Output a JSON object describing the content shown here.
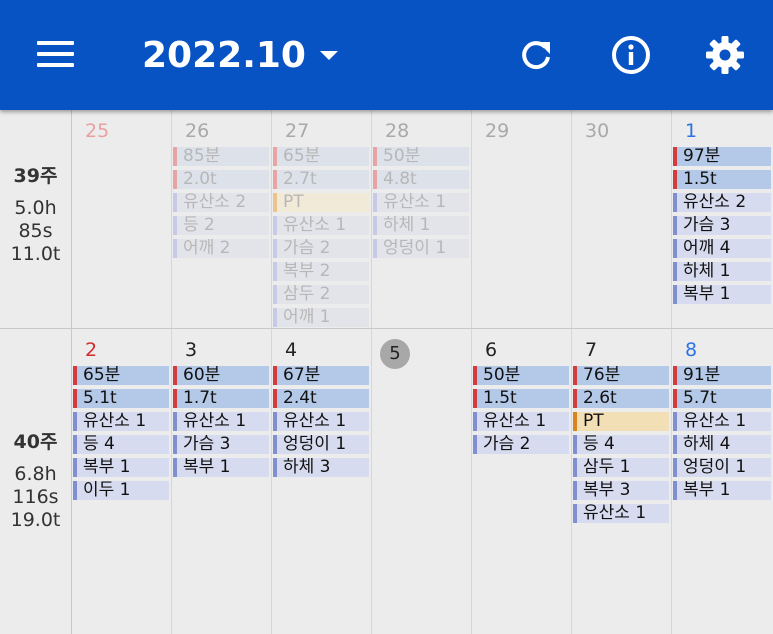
{
  "header": {
    "month": "2022.10",
    "icons": [
      "menu-icon",
      "refresh-icon",
      "info-icon",
      "settings-icon"
    ],
    "color": "#0853c3"
  },
  "weeks": [
    {
      "title": "39주",
      "stats": [
        "5.0h",
        "85s",
        "11.0t"
      ],
      "days": [
        {
          "num": "25",
          "kind": "sun",
          "past": true,
          "items": []
        },
        {
          "num": "26",
          "kind": "",
          "past": true,
          "items": [
            {
              "text": "85분",
              "type": "time"
            },
            {
              "text": "2.0t",
              "type": "ton"
            },
            {
              "text": "유산소 2",
              "type": "ex"
            },
            {
              "text": "등 2",
              "type": "ex"
            },
            {
              "text": "어깨 2",
              "type": "ex"
            }
          ]
        },
        {
          "num": "27",
          "kind": "",
          "past": true,
          "items": [
            {
              "text": "65분",
              "type": "time"
            },
            {
              "text": "2.7t",
              "type": "ton"
            },
            {
              "text": "PT",
              "type": "pt"
            },
            {
              "text": "유산소 1",
              "type": "ex"
            },
            {
              "text": "가슴 2",
              "type": "ex"
            },
            {
              "text": "복부 2",
              "type": "ex"
            },
            {
              "text": "삼두 2",
              "type": "ex"
            },
            {
              "text": "어깨 1",
              "type": "ex"
            }
          ]
        },
        {
          "num": "28",
          "kind": "",
          "past": true,
          "items": [
            {
              "text": "50분",
              "type": "time"
            },
            {
              "text": "4.8t",
              "type": "ton"
            },
            {
              "text": "유산소 1",
              "type": "ex"
            },
            {
              "text": "하체 1",
              "type": "ex"
            },
            {
              "text": "엉덩이 1",
              "type": "ex"
            }
          ]
        },
        {
          "num": "29",
          "kind": "",
          "past": true,
          "items": []
        },
        {
          "num": "30",
          "kind": "",
          "past": true,
          "items": []
        },
        {
          "num": "1",
          "kind": "sat",
          "past": false,
          "items": [
            {
              "text": "97분",
              "type": "time"
            },
            {
              "text": "1.5t",
              "type": "ton"
            },
            {
              "text": "유산소 2",
              "type": "ex"
            },
            {
              "text": "가슴 3",
              "type": "ex"
            },
            {
              "text": "어깨 4",
              "type": "ex"
            },
            {
              "text": "하체 1",
              "type": "ex"
            },
            {
              "text": "복부 1",
              "type": "ex"
            }
          ]
        }
      ]
    },
    {
      "title": "40주",
      "stats": [
        "6.8h",
        "116s",
        "19.0t"
      ],
      "days": [
        {
          "num": "2",
          "kind": "sun",
          "past": false,
          "items": [
            {
              "text": "65분",
              "type": "time"
            },
            {
              "text": "5.1t",
              "type": "ton"
            },
            {
              "text": "유산소 1",
              "type": "ex"
            },
            {
              "text": "등 4",
              "type": "ex"
            },
            {
              "text": "복부 1",
              "type": "ex"
            },
            {
              "text": "이두 1",
              "type": "ex"
            }
          ]
        },
        {
          "num": "3",
          "kind": "",
          "past": false,
          "items": [
            {
              "text": "60분",
              "type": "time"
            },
            {
              "text": "1.7t",
              "type": "ton"
            },
            {
              "text": "유산소 1",
              "type": "ex"
            },
            {
              "text": "가슴 3",
              "type": "ex"
            },
            {
              "text": "복부 1",
              "type": "ex"
            }
          ]
        },
        {
          "num": "4",
          "kind": "",
          "past": false,
          "items": [
            {
              "text": "67분",
              "type": "time"
            },
            {
              "text": "2.4t",
              "type": "ton"
            },
            {
              "text": "유산소 1",
              "type": "ex"
            },
            {
              "text": "엉덩이 1",
              "type": "ex"
            },
            {
              "text": "하체 3",
              "type": "ex"
            }
          ]
        },
        {
          "num": "5",
          "kind": "today",
          "past": false,
          "items": []
        },
        {
          "num": "6",
          "kind": "",
          "past": false,
          "items": [
            {
              "text": "50분",
              "type": "time"
            },
            {
              "text": "1.5t",
              "type": "ton"
            },
            {
              "text": "유산소 1",
              "type": "ex"
            },
            {
              "text": "가슴 2",
              "type": "ex"
            }
          ]
        },
        {
          "num": "7",
          "kind": "",
          "past": false,
          "items": [
            {
              "text": "76분",
              "type": "time"
            },
            {
              "text": "2.6t",
              "type": "ton"
            },
            {
              "text": "PT",
              "type": "pt"
            },
            {
              "text": "등 4",
              "type": "ex"
            },
            {
              "text": "삼두 1",
              "type": "ex"
            },
            {
              "text": "복부 3",
              "type": "ex"
            },
            {
              "text": "유산소 1",
              "type": "ex"
            }
          ]
        },
        {
          "num": "8",
          "kind": "sat",
          "past": false,
          "items": [
            {
              "text": "91분",
              "type": "time"
            },
            {
              "text": "5.7t",
              "type": "ton"
            },
            {
              "text": "유산소 1",
              "type": "ex"
            },
            {
              "text": "하체 4",
              "type": "ex"
            },
            {
              "text": "엉덩이 1",
              "type": "ex"
            },
            {
              "text": "복부 1",
              "type": "ex"
            }
          ]
        }
      ]
    }
  ]
}
